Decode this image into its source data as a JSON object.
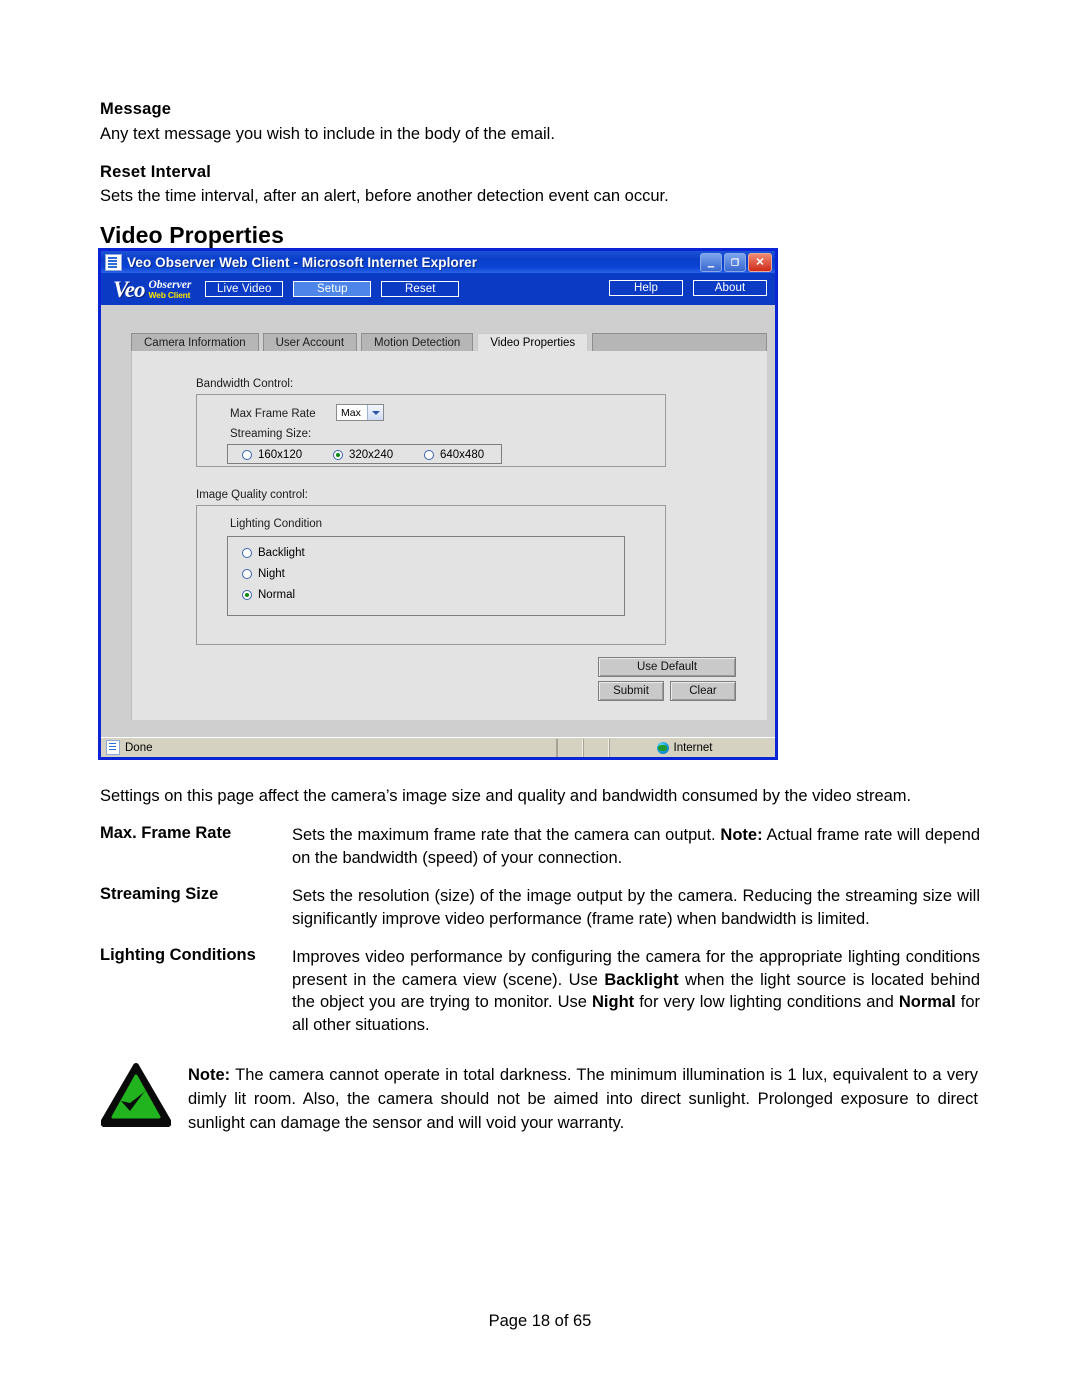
{
  "document": {
    "sections": [
      {
        "heading": "Message",
        "body": "Any text message you wish to include in the body of the email."
      },
      {
        "heading": "Reset Interval",
        "body": "Sets the time interval, after an alert, before another detection event can occur."
      }
    ],
    "title": "Video Properties",
    "intro": "Settings on this page affect the camera’s image size and quality and bandwidth consumed by the video stream.",
    "definitions": [
      {
        "term": "Max. Frame Rate",
        "html": "Sets the maximum frame rate that the camera can output. <b>Note:</b> Actual frame rate will depend on the bandwidth (speed) of your connection."
      },
      {
        "term": "Streaming Size",
        "html": "Sets the resolution (size) of the image output by the camera. Reducing the streaming size will significantly improve video performance (frame rate) when bandwidth is limited."
      },
      {
        "term": "Lighting Conditions",
        "html": "Improves video performance by configuring the camera for the appropriate lighting conditions present in the camera view (scene). Use <b>Backlight</b> when the light source is located behind the object you are trying to monitor. Use <b>Night</b> for very low lighting conditions and <b>Normal</b> for all other situations."
      }
    ],
    "note": {
      "icon": "green-check-triangle-icon",
      "html": "<b>Note:</b> The camera cannot operate in total darkness. The minimum illumination is 1 lux, equivalent to a very dimly lit room. Also, the camera should not be aimed into direct sunlight. Prolonged exposure to direct sunlight can damage the sensor and will void your warranty."
    },
    "footer": "Page 18 of 65"
  },
  "screenshot": {
    "window": {
      "title": "Veo Observer Web Client - Microsoft Internet Explorer",
      "title_icon": "ie-page-icon",
      "controls": {
        "minimize": "–",
        "maximize": "❐",
        "close": "✕"
      }
    },
    "brand": {
      "name": "Veo",
      "line1": "Observer",
      "line2": "Web Client"
    },
    "nav": {
      "left": [
        {
          "label": "Live Video",
          "active": false
        },
        {
          "label": "Setup",
          "active": true
        },
        {
          "label": "Reset",
          "active": false
        }
      ],
      "right": [
        {
          "label": "Help"
        },
        {
          "label": "About"
        }
      ]
    },
    "tabs": [
      {
        "label": "Camera Information",
        "active": false
      },
      {
        "label": "User Account",
        "active": false
      },
      {
        "label": "Motion Detection",
        "active": false
      },
      {
        "label": "Video Properties",
        "active": true
      }
    ],
    "bandwidth": {
      "group_label": "Bandwidth Control:",
      "frame_rate_label": "Max Frame Rate",
      "frame_rate_value": "Max",
      "streaming_label": "Streaming Size:",
      "streaming_options": [
        {
          "label": "160x120",
          "selected": false
        },
        {
          "label": "320x240",
          "selected": true
        },
        {
          "label": "640x480",
          "selected": false
        }
      ]
    },
    "image_quality": {
      "group_label": "Image Quality control:",
      "lighting_label": "Lighting Condition",
      "lighting_options": [
        {
          "label": "Backlight",
          "selected": false
        },
        {
          "label": "Night",
          "selected": false
        },
        {
          "label": "Normal",
          "selected": true
        }
      ]
    },
    "buttons": {
      "use_default": "Use Default",
      "submit": "Submit",
      "clear": "Clear"
    },
    "statusbar": {
      "status": "Done",
      "status_icon": "ie-page-icon",
      "zone": "Internet",
      "zone_icon": "internet-globe-icon"
    },
    "colors": {
      "titlebar_blue": "#0a3ec9",
      "window_border": "#0a24d6",
      "nav_active": "#4d86e8",
      "radio_dot": "#0b8a17",
      "brand_yellow": "#ffe400",
      "note_green": "#22b41e"
    }
  }
}
